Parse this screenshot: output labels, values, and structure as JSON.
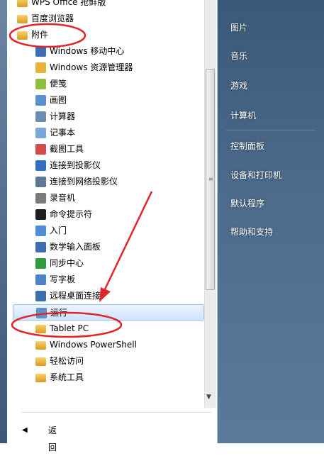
{
  "programs": [
    {
      "label": "WPS Office 抢鲜版",
      "icon": "wps-folder-icon",
      "type": "folder",
      "level": 0
    },
    {
      "label": "百度浏览器",
      "icon": "baidu-folder-icon",
      "type": "folder",
      "level": 0
    },
    {
      "label": "附件",
      "icon": "accessories-folder-icon",
      "type": "folder",
      "level": 0
    },
    {
      "label": "Windows 移动中心",
      "icon": "mobility-center-icon",
      "type": "app",
      "level": 1,
      "color": "#3b6fb6"
    },
    {
      "label": "Windows 资源管理器",
      "icon": "explorer-icon",
      "type": "app",
      "level": 1,
      "color": "#e4b53a"
    },
    {
      "label": "便笺",
      "icon": "sticky-notes-icon",
      "type": "app",
      "level": 1,
      "color": "#8bbf3c"
    },
    {
      "label": "画图",
      "icon": "paint-icon",
      "type": "app",
      "level": 1,
      "color": "#5a8fd0"
    },
    {
      "label": "计算器",
      "icon": "calculator-icon",
      "type": "app",
      "level": 1,
      "color": "#6c8db3"
    },
    {
      "label": "记事本",
      "icon": "notepad-icon",
      "type": "app",
      "level": 1,
      "color": "#7aa6d8"
    },
    {
      "label": "截图工具",
      "icon": "snipping-tool-icon",
      "type": "app",
      "level": 1,
      "color": "#d14b4b"
    },
    {
      "label": "连接到投影仪",
      "icon": "projector-icon",
      "type": "app",
      "level": 1,
      "color": "#2f6fc1"
    },
    {
      "label": "连接到网络投影仪",
      "icon": "network-projector-icon",
      "type": "app",
      "level": 1,
      "color": "#5d7797"
    },
    {
      "label": "录音机",
      "icon": "sound-recorder-icon",
      "type": "app",
      "level": 1,
      "color": "#7b7b7b"
    },
    {
      "label": "命令提示符",
      "icon": "cmd-icon",
      "type": "app",
      "level": 1,
      "color": "#1e1e1e"
    },
    {
      "label": "入门",
      "icon": "getting-started-icon",
      "type": "app",
      "level": 1,
      "color": "#4f8ed6"
    },
    {
      "label": "数学输入面板",
      "icon": "math-input-icon",
      "type": "app",
      "level": 1,
      "color": "#3d6cb0"
    },
    {
      "label": "同步中心",
      "icon": "sync-center-icon",
      "type": "app",
      "level": 1,
      "color": "#2d9c3a"
    },
    {
      "label": "写字板",
      "icon": "wordpad-icon",
      "type": "app",
      "level": 1,
      "color": "#4b82c8"
    },
    {
      "label": "远程桌面连接",
      "icon": "remote-desktop-icon",
      "type": "app",
      "level": 1,
      "color": "#3a6fb0"
    },
    {
      "label": "运行",
      "icon": "run-icon",
      "type": "app",
      "level": 1,
      "color": "#5e8fc9",
      "selected": true
    },
    {
      "label": "Tablet PC",
      "icon": "tablet-pc-folder-icon",
      "type": "folder",
      "level": 1
    },
    {
      "label": "Windows PowerShell",
      "icon": "powershell-folder-icon",
      "type": "folder",
      "level": 1
    },
    {
      "label": "轻松访问",
      "icon": "ease-of-access-folder-icon",
      "type": "folder",
      "level": 1
    },
    {
      "label": "系统工具",
      "icon": "system-tools-folder-icon",
      "type": "folder",
      "level": 1
    }
  ],
  "back_label": "返回",
  "right_menu": [
    {
      "label": "图片"
    },
    {
      "label": "音乐"
    },
    {
      "label": "游戏"
    },
    {
      "label": "计算机"
    },
    {
      "label": "控制面板"
    },
    {
      "label": "设备和打印机"
    },
    {
      "label": "默认程序"
    },
    {
      "label": "帮助和支持"
    }
  ],
  "annotation_color": "#e0262c"
}
